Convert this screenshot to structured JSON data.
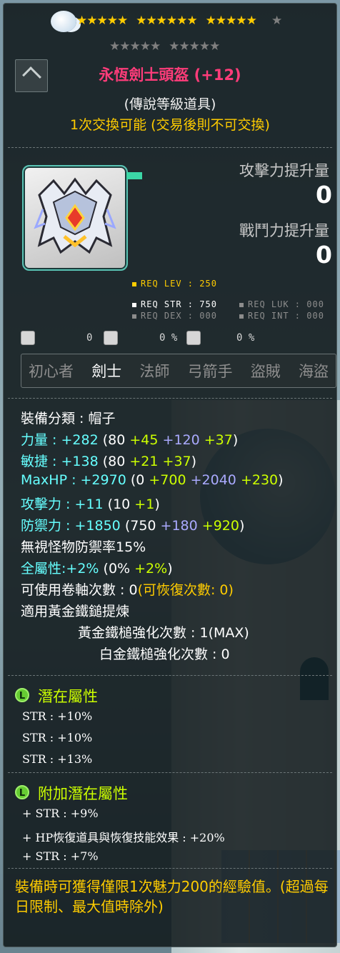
{
  "tooltip": {
    "stars": {
      "filled": 16,
      "total": 25,
      "rows": [
        [
          5,
          6,
          5
        ],
        [
          5,
          5,
          5
        ]
      ]
    },
    "item_name": "永恆劍士頭盔 (+12)",
    "grade": "(傳說等級道具)",
    "trade_info": "1次交換可能 (交易後則不可交換)",
    "compare": {
      "atk_label": "攻擊力提升量",
      "atk_value": "0",
      "power_label": "戰鬥力提升量",
      "power_value": "0"
    },
    "requirements": {
      "lev": "REQ LEV : 250",
      "str": "REQ STR : 750",
      "luk": "REQ LUK : 000",
      "dex": "REQ DEX : 000",
      "int": "REQ INT : 000"
    },
    "mini_stats": [
      "0",
      "0 %",
      "0 %"
    ],
    "jobs": [
      "初心者",
      "劍士",
      "法師",
      "弓箭手",
      "盜賊",
      "海盜"
    ],
    "active_job": "劍士",
    "stats": {
      "category": "裝備分類 : 帽子",
      "str": {
        "label": "力量",
        "total": "+282",
        "base": "(80 ",
        "b1": "+45",
        "b2": "+120",
        "b3": "+37",
        "close": ")"
      },
      "dex": {
        "label": "敏捷",
        "total": "+138",
        "base": "(80 ",
        "b1": "+21",
        "b3": "+37",
        "close": ")"
      },
      "maxhp": {
        "label": "MaxHP",
        "total": "+2970",
        "base": "(0 ",
        "b1": "+700",
        "b2": "+2040",
        "b3": "+230",
        "close": ")"
      },
      "atk": {
        "label": "攻擊力",
        "total": "+11",
        "base": "(10 ",
        "b3": "+1",
        "close": ")"
      },
      "def": {
        "label": "防禦力",
        "total": "+1850",
        "base": "(750 ",
        "b2": "+180",
        "b3": "+920",
        "close": ")"
      },
      "ignore_def": "無視怪物防禦率15%",
      "all_stat": {
        "label": "全屬性",
        "total": "+2%",
        "base": "(0% ",
        "b1": "+2%",
        "close": ")"
      },
      "scroll_slots": "可使用卷軸次數 : 0",
      "scroll_recover": "(可恢復次數: 0)",
      "golden_hammer": "適用黃金鐵鎚提煉",
      "golden_count": "黃金鐵槌強化次數 : 1(MAX)",
      "platinum_count": "白金鐵槌強化次數 : 0"
    },
    "potential": {
      "badge": "L",
      "title": "潛在屬性",
      "lines": [
        "STR : +10%",
        "STR : +10%",
        "STR : +13%"
      ]
    },
    "bonus_potential": {
      "badge": "L",
      "title": "附加潛在屬性",
      "lines": [
        "+ STR : +9%",
        "+ HP恢復道具與恢復技能效果 : +20%",
        "+ STR : +7%"
      ]
    },
    "description": "裝備時可獲得僅限1次魅力200的經驗值。(超過每日限制、最大值時除外)"
  },
  "colors": {
    "name": "#ff3c7a",
    "trade": "#ffcc00",
    "stat_label": "#66ffff",
    "bonus_green": "#ccff00",
    "bonus_blue": "#aaaaff",
    "potential_title": "#ccff00"
  }
}
